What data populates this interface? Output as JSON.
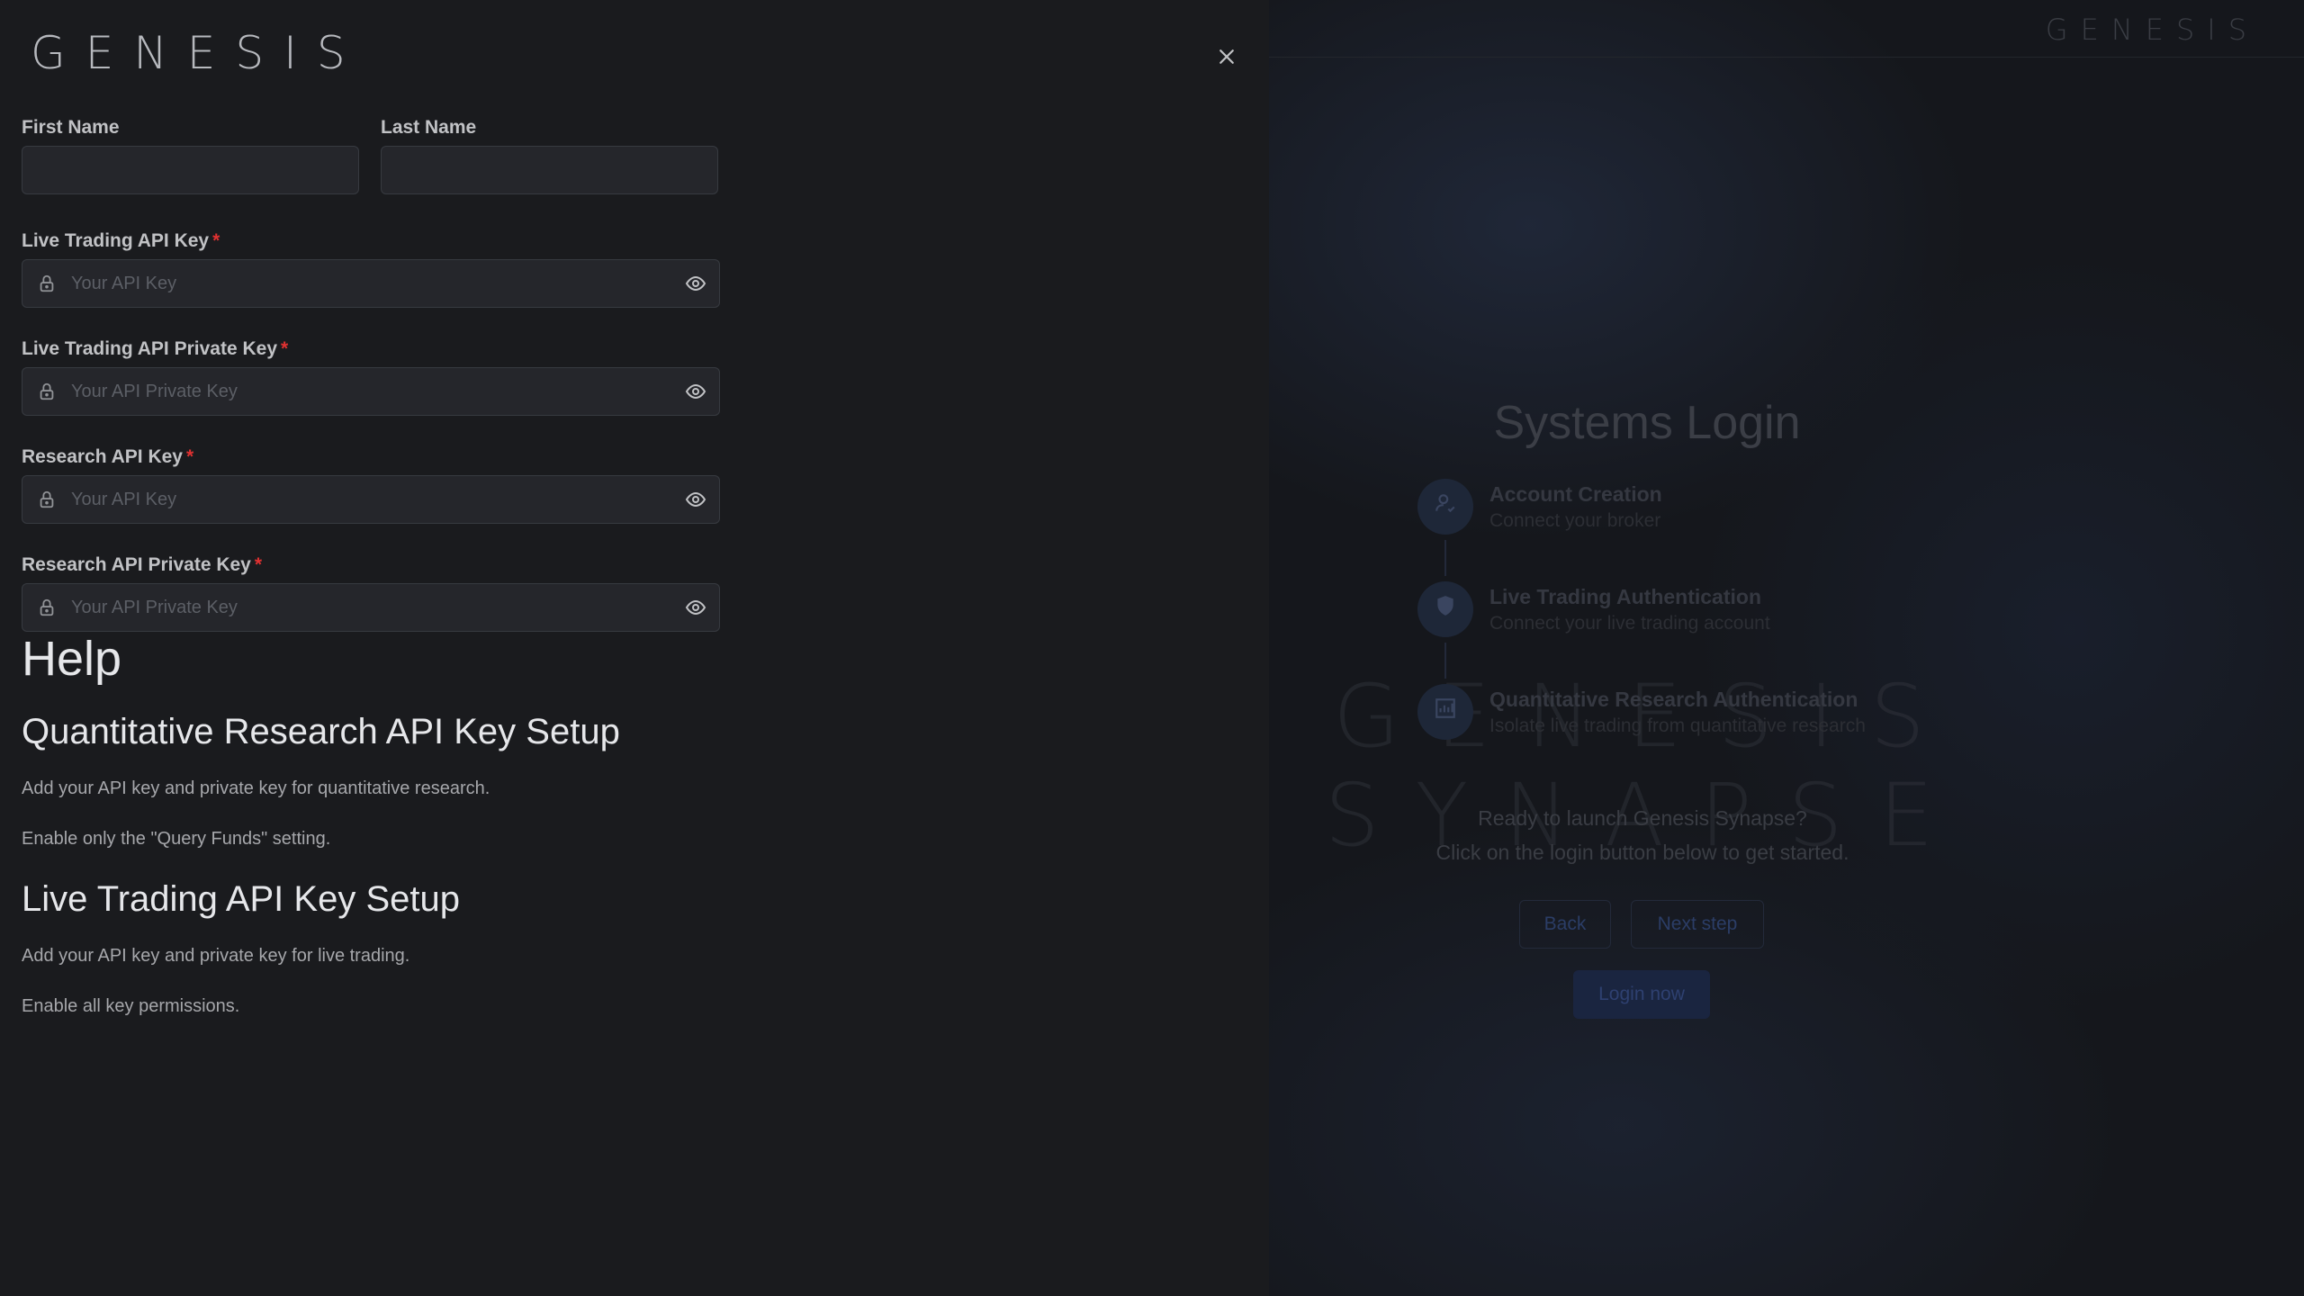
{
  "background": {
    "header_logo": "GENESIS",
    "watermark": [
      "GENESIS",
      "SYNAPSE"
    ],
    "title": "Systems Login",
    "steps": [
      {
        "title": "Account Creation",
        "subtitle": "Connect your broker",
        "icon": "user-check-icon"
      },
      {
        "title": "Live Trading Authentication",
        "subtitle": "Connect your live trading account",
        "icon": "shield-icon"
      },
      {
        "title": "Quantitative Research Authentication",
        "subtitle": "Isolate live trading from quantitative research",
        "icon": "chart-icon"
      }
    ],
    "ready_line1": "Ready to launch Genesis Synapse?",
    "ready_line2": "Click on the login button below to get started.",
    "back_label": "Back",
    "next_label": "Next step",
    "login_label": "Login now"
  },
  "drawer": {
    "logo": "GENESIS",
    "close_icon": "close-icon",
    "first_name_label": "First Name",
    "first_name_value": "",
    "last_name_label": "Last Name",
    "last_name_value": "",
    "fields": [
      {
        "label": "Live Trading API Key",
        "placeholder": "Your API Key",
        "required": "*"
      },
      {
        "label": "Live Trading API Private Key",
        "placeholder": "Your API Private Key",
        "required": "*"
      },
      {
        "label": "Research API Key",
        "placeholder": "Your API Key",
        "required": "*"
      },
      {
        "label": "Research API Private Key",
        "placeholder": "Your API Private Key",
        "required": "*"
      }
    ]
  },
  "help": {
    "title": "Help",
    "sections": [
      {
        "heading": "Quantitative Research API Key Setup",
        "lines": [
          "Add your API key and private key for quantitative research.",
          "Enable only the \"Query Funds\" setting."
        ]
      },
      {
        "heading": "Live Trading API Key Setup",
        "lines": [
          "Add your API key and private key for live trading.",
          "Enable all key permissions."
        ]
      }
    ]
  },
  "colors": {
    "drawer_bg": "#1a1b1e",
    "input_bg": "#25262b",
    "input_border": "#373a40",
    "required": "#e03131",
    "accent": "#2b3d66"
  }
}
